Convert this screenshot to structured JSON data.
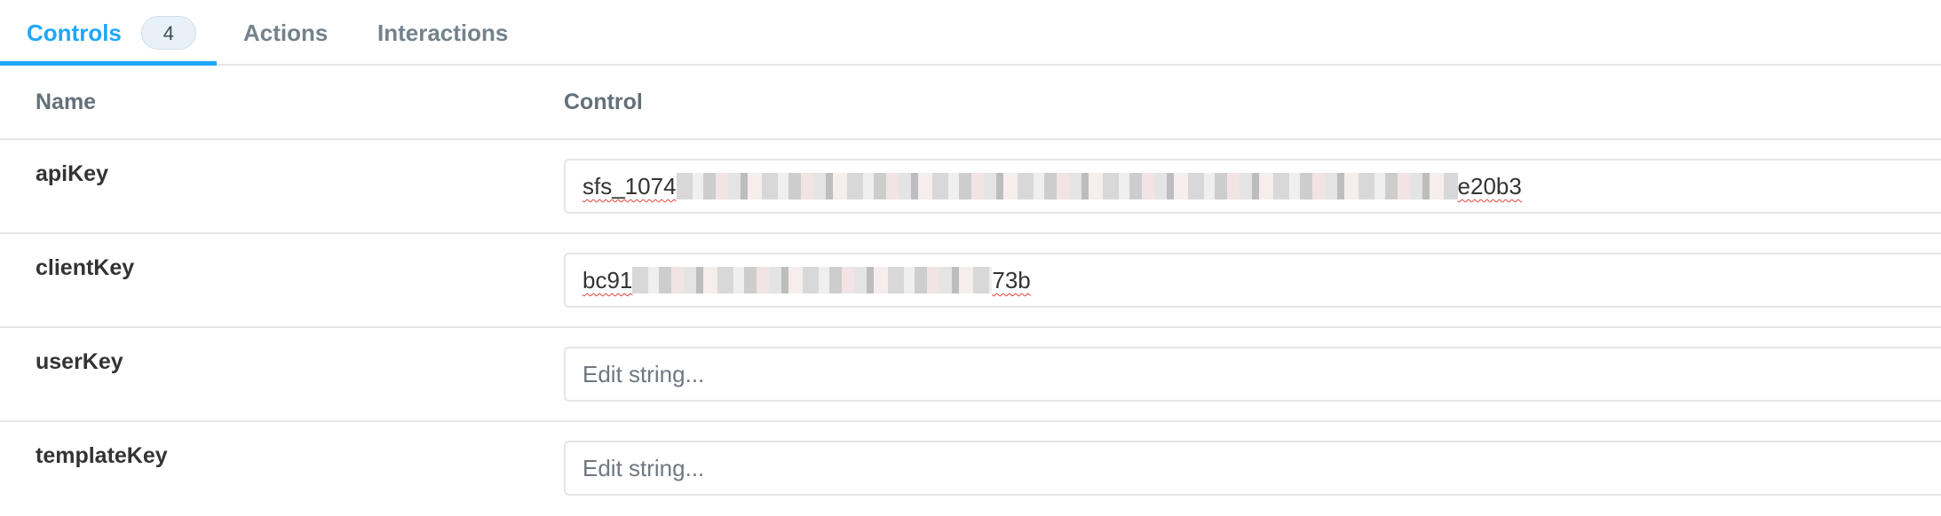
{
  "tabs": [
    {
      "label": "Controls",
      "badge": "4",
      "active": true
    },
    {
      "label": "Actions",
      "active": false
    },
    {
      "label": "Interactions",
      "active": false
    }
  ],
  "table": {
    "columns": {
      "name": "Name",
      "control": "Control"
    },
    "rows": [
      {
        "name": "apiKey",
        "value_start": "sfs_1074",
        "value_end": "e20b3",
        "redacted": true
      },
      {
        "name": "clientKey",
        "value_start": "bc91",
        "value_end": "73b",
        "redacted": true
      },
      {
        "name": "userKey",
        "placeholder": "Edit string..."
      },
      {
        "name": "templateKey",
        "placeholder": "Edit string..."
      }
    ]
  },
  "colors": {
    "accent": "#1ea7fd",
    "border": "#e6e6e6"
  }
}
